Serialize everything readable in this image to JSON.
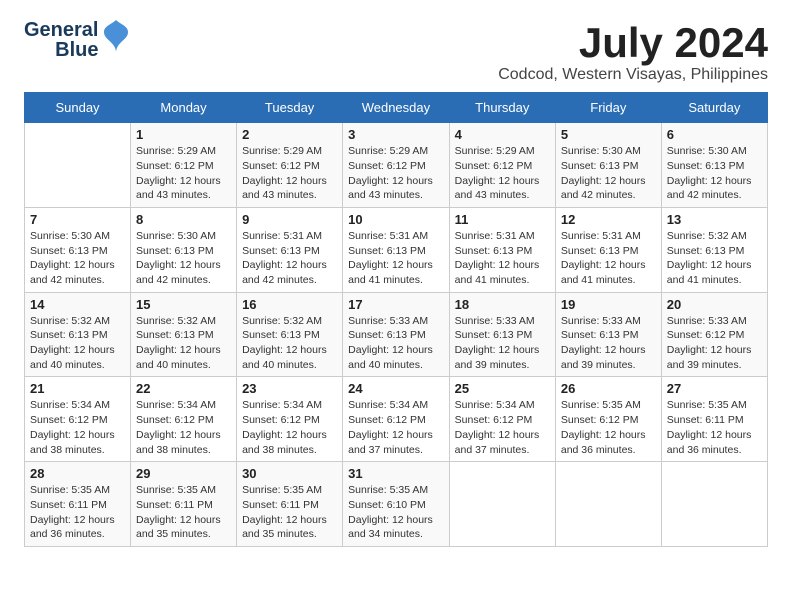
{
  "logo": {
    "line1": "General",
    "line2": "Blue"
  },
  "title": {
    "month_year": "July 2024",
    "location": "Codcod, Western Visayas, Philippines"
  },
  "weekdays": [
    "Sunday",
    "Monday",
    "Tuesday",
    "Wednesday",
    "Thursday",
    "Friday",
    "Saturday"
  ],
  "weeks": [
    [
      {
        "day": null
      },
      {
        "day": "1",
        "sunrise": "Sunrise: 5:29 AM",
        "sunset": "Sunset: 6:12 PM",
        "daylight": "Daylight: 12 hours and 43 minutes."
      },
      {
        "day": "2",
        "sunrise": "Sunrise: 5:29 AM",
        "sunset": "Sunset: 6:12 PM",
        "daylight": "Daylight: 12 hours and 43 minutes."
      },
      {
        "day": "3",
        "sunrise": "Sunrise: 5:29 AM",
        "sunset": "Sunset: 6:12 PM",
        "daylight": "Daylight: 12 hours and 43 minutes."
      },
      {
        "day": "4",
        "sunrise": "Sunrise: 5:29 AM",
        "sunset": "Sunset: 6:12 PM",
        "daylight": "Daylight: 12 hours and 43 minutes."
      },
      {
        "day": "5",
        "sunrise": "Sunrise: 5:30 AM",
        "sunset": "Sunset: 6:13 PM",
        "daylight": "Daylight: 12 hours and 42 minutes."
      },
      {
        "day": "6",
        "sunrise": "Sunrise: 5:30 AM",
        "sunset": "Sunset: 6:13 PM",
        "daylight": "Daylight: 12 hours and 42 minutes."
      }
    ],
    [
      {
        "day": "7",
        "sunrise": "Sunrise: 5:30 AM",
        "sunset": "Sunset: 6:13 PM",
        "daylight": "Daylight: 12 hours and 42 minutes."
      },
      {
        "day": "8",
        "sunrise": "Sunrise: 5:30 AM",
        "sunset": "Sunset: 6:13 PM",
        "daylight": "Daylight: 12 hours and 42 minutes."
      },
      {
        "day": "9",
        "sunrise": "Sunrise: 5:31 AM",
        "sunset": "Sunset: 6:13 PM",
        "daylight": "Daylight: 12 hours and 42 minutes."
      },
      {
        "day": "10",
        "sunrise": "Sunrise: 5:31 AM",
        "sunset": "Sunset: 6:13 PM",
        "daylight": "Daylight: 12 hours and 41 minutes."
      },
      {
        "day": "11",
        "sunrise": "Sunrise: 5:31 AM",
        "sunset": "Sunset: 6:13 PM",
        "daylight": "Daylight: 12 hours and 41 minutes."
      },
      {
        "day": "12",
        "sunrise": "Sunrise: 5:31 AM",
        "sunset": "Sunset: 6:13 PM",
        "daylight": "Daylight: 12 hours and 41 minutes."
      },
      {
        "day": "13",
        "sunrise": "Sunrise: 5:32 AM",
        "sunset": "Sunset: 6:13 PM",
        "daylight": "Daylight: 12 hours and 41 minutes."
      }
    ],
    [
      {
        "day": "14",
        "sunrise": "Sunrise: 5:32 AM",
        "sunset": "Sunset: 6:13 PM",
        "daylight": "Daylight: 12 hours and 40 minutes."
      },
      {
        "day": "15",
        "sunrise": "Sunrise: 5:32 AM",
        "sunset": "Sunset: 6:13 PM",
        "daylight": "Daylight: 12 hours and 40 minutes."
      },
      {
        "day": "16",
        "sunrise": "Sunrise: 5:32 AM",
        "sunset": "Sunset: 6:13 PM",
        "daylight": "Daylight: 12 hours and 40 minutes."
      },
      {
        "day": "17",
        "sunrise": "Sunrise: 5:33 AM",
        "sunset": "Sunset: 6:13 PM",
        "daylight": "Daylight: 12 hours and 40 minutes."
      },
      {
        "day": "18",
        "sunrise": "Sunrise: 5:33 AM",
        "sunset": "Sunset: 6:13 PM",
        "daylight": "Daylight: 12 hours and 39 minutes."
      },
      {
        "day": "19",
        "sunrise": "Sunrise: 5:33 AM",
        "sunset": "Sunset: 6:13 PM",
        "daylight": "Daylight: 12 hours and 39 minutes."
      },
      {
        "day": "20",
        "sunrise": "Sunrise: 5:33 AM",
        "sunset": "Sunset: 6:12 PM",
        "daylight": "Daylight: 12 hours and 39 minutes."
      }
    ],
    [
      {
        "day": "21",
        "sunrise": "Sunrise: 5:34 AM",
        "sunset": "Sunset: 6:12 PM",
        "daylight": "Daylight: 12 hours and 38 minutes."
      },
      {
        "day": "22",
        "sunrise": "Sunrise: 5:34 AM",
        "sunset": "Sunset: 6:12 PM",
        "daylight": "Daylight: 12 hours and 38 minutes."
      },
      {
        "day": "23",
        "sunrise": "Sunrise: 5:34 AM",
        "sunset": "Sunset: 6:12 PM",
        "daylight": "Daylight: 12 hours and 38 minutes."
      },
      {
        "day": "24",
        "sunrise": "Sunrise: 5:34 AM",
        "sunset": "Sunset: 6:12 PM",
        "daylight": "Daylight: 12 hours and 37 minutes."
      },
      {
        "day": "25",
        "sunrise": "Sunrise: 5:34 AM",
        "sunset": "Sunset: 6:12 PM",
        "daylight": "Daylight: 12 hours and 37 minutes."
      },
      {
        "day": "26",
        "sunrise": "Sunrise: 5:35 AM",
        "sunset": "Sunset: 6:12 PM",
        "daylight": "Daylight: 12 hours and 36 minutes."
      },
      {
        "day": "27",
        "sunrise": "Sunrise: 5:35 AM",
        "sunset": "Sunset: 6:11 PM",
        "daylight": "Daylight: 12 hours and 36 minutes."
      }
    ],
    [
      {
        "day": "28",
        "sunrise": "Sunrise: 5:35 AM",
        "sunset": "Sunset: 6:11 PM",
        "daylight": "Daylight: 12 hours and 36 minutes."
      },
      {
        "day": "29",
        "sunrise": "Sunrise: 5:35 AM",
        "sunset": "Sunset: 6:11 PM",
        "daylight": "Daylight: 12 hours and 35 minutes."
      },
      {
        "day": "30",
        "sunrise": "Sunrise: 5:35 AM",
        "sunset": "Sunset: 6:11 PM",
        "daylight": "Daylight: 12 hours and 35 minutes."
      },
      {
        "day": "31",
        "sunrise": "Sunrise: 5:35 AM",
        "sunset": "Sunset: 6:10 PM",
        "daylight": "Daylight: 12 hours and 34 minutes."
      },
      {
        "day": null
      },
      {
        "day": null
      },
      {
        "day": null
      }
    ]
  ]
}
